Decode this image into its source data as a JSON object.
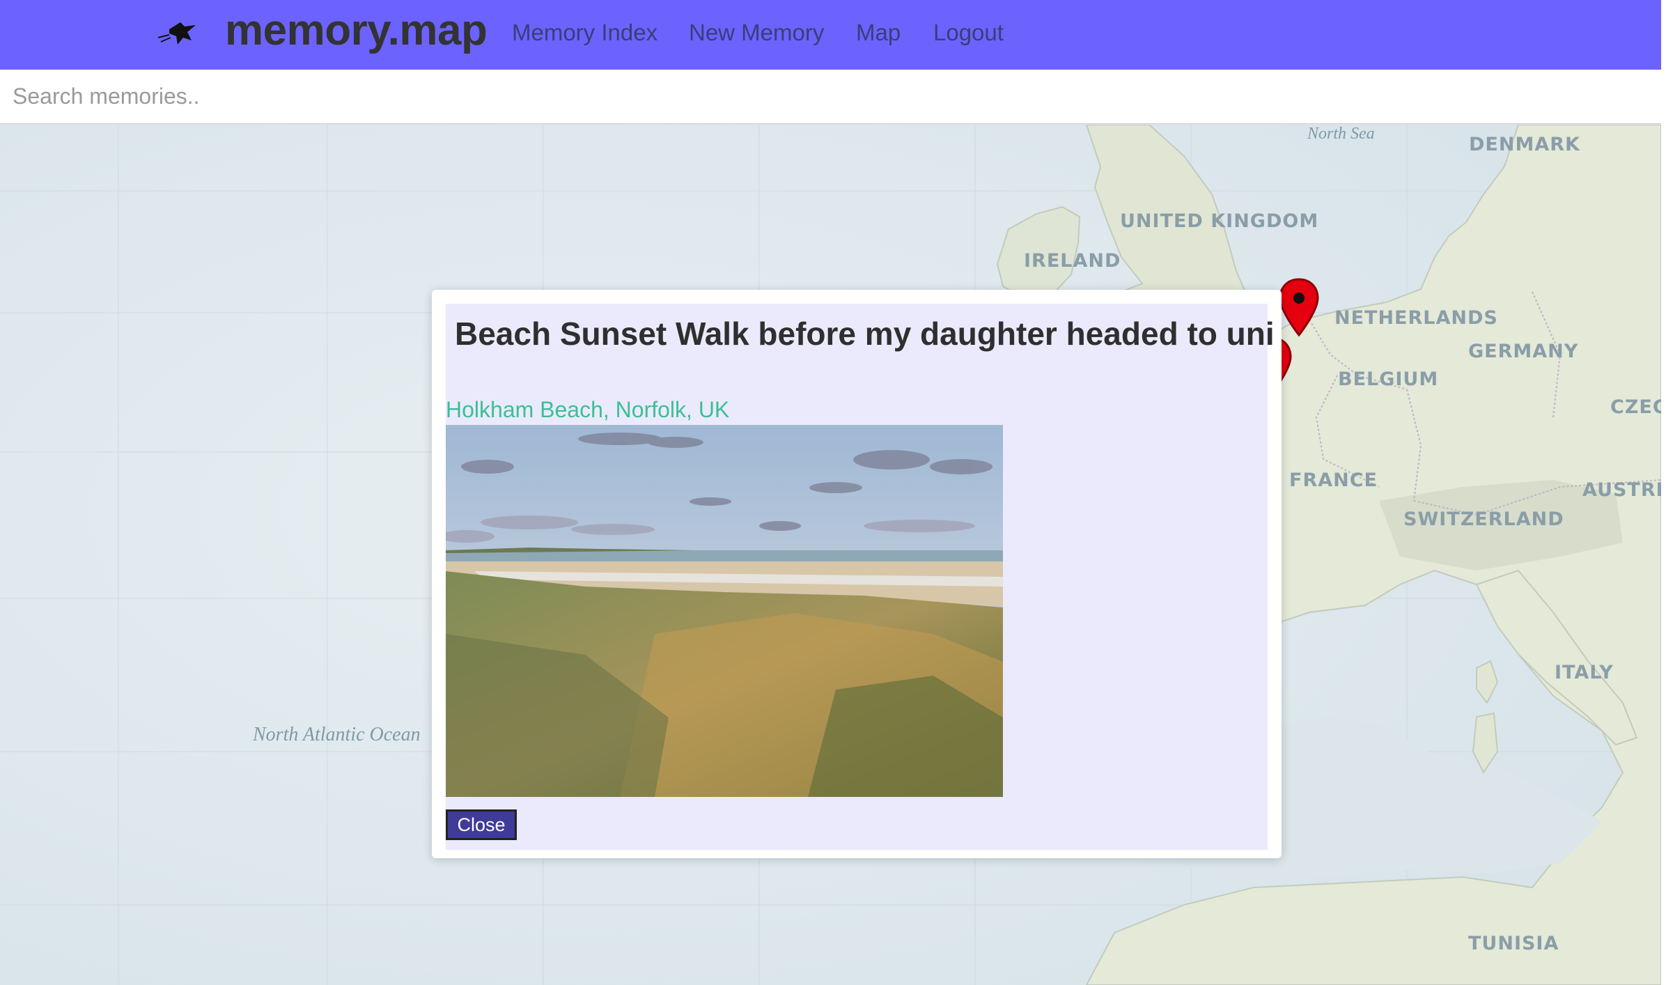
{
  "navbar": {
    "brand": "memory.map",
    "brand_icon": "bird-icon",
    "links": [
      "Memory Index",
      "New Memory",
      "Map",
      "Logout"
    ],
    "background": "#6c63ff"
  },
  "search": {
    "placeholder": "Search memories..",
    "value": ""
  },
  "map": {
    "countries": [
      "DENMARK",
      "UNITED KINGDOM",
      "IRELAND",
      "NETHERLANDS",
      "GERMANY",
      "BELGIUM",
      "CZEC",
      "FRANCE",
      "AUSTRIA",
      "SWITZERLAND",
      "ITALY",
      "TUNISIA"
    ],
    "seas": [
      "North Sea",
      "North Atlantic Ocean"
    ],
    "marker_icon": "map-pin-icon",
    "marker_color": "#e4000f"
  },
  "modal": {
    "title": "Beach Sunset Walk before my daughter headed to uni",
    "location": "Holkham Beach, Norfolk, UK",
    "photo_icon": "beach-dunes-photo",
    "close_label": "Close"
  }
}
